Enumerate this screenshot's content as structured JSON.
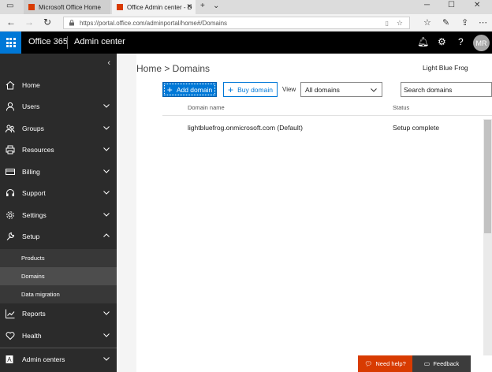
{
  "browser": {
    "tabs": [
      {
        "label": "Microsoft Office Home",
        "favicon_color": "#d83b01"
      },
      {
        "label": "Office Admin center - D",
        "favicon_color": "#d83b01"
      }
    ],
    "url": "https://portal.office.com/adminportal/home#/Domains"
  },
  "suite": {
    "brand": "Office 365",
    "app": "Admin center",
    "avatar_initials": "MR",
    "waffle_color": "#0078d7"
  },
  "nav": {
    "items": [
      {
        "label": "Home",
        "icon": "home-icon"
      },
      {
        "label": "Users",
        "icon": "user-icon"
      },
      {
        "label": "Groups",
        "icon": "groups-icon"
      },
      {
        "label": "Resources",
        "icon": "printer-icon"
      },
      {
        "label": "Billing",
        "icon": "credit-card-icon"
      },
      {
        "label": "Support",
        "icon": "headset-icon"
      },
      {
        "label": "Settings",
        "icon": "gear-icon"
      },
      {
        "label": "Setup",
        "icon": "wrench-icon"
      }
    ],
    "setup_subitems": [
      "Products",
      "Domains",
      "Data migration"
    ],
    "bottom_items": [
      {
        "label": "Reports",
        "icon": "chart-icon"
      },
      {
        "label": "Health",
        "icon": "heart-icon"
      },
      {
        "label": "Admin centers",
        "icon": "admin-centers-icon"
      }
    ]
  },
  "main": {
    "breadcrumb": "Home > Domains",
    "tenant": "Light Blue Frog",
    "add_domain": "Add domain",
    "buy_domain": "Buy domain",
    "view_label": "View",
    "view_value": "All domains",
    "search_placeholder": "Search domains",
    "columns": [
      "Domain name",
      "Status"
    ],
    "rows": [
      {
        "domain": "lightbluefrog.onmicrosoft.com (Default)",
        "status": "Setup complete"
      }
    ],
    "need_help": "Need help?",
    "feedback": "Feedback"
  },
  "colors": {
    "accent": "#0078d7",
    "help": "#d83b01",
    "nav_bg": "#2b2b2b"
  }
}
